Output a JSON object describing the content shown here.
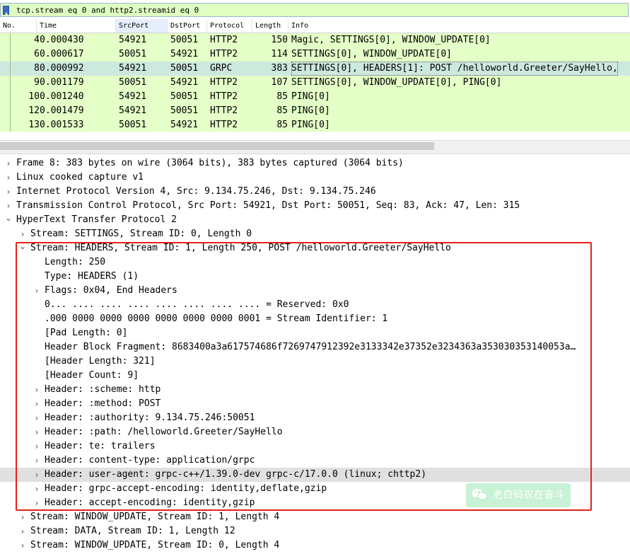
{
  "filter": {
    "value": "tcp.stream eq 0 and http2.streamid eq 0"
  },
  "columns": [
    "No.",
    "Time",
    "SrcPort",
    "DstPort",
    "Protocol",
    "Length",
    "Info"
  ],
  "packets": [
    {
      "no": "4",
      "time": "0.000430",
      "src": "54921",
      "dst": "50051",
      "proto": "HTTP2",
      "len": "150",
      "info": "Magic, SETTINGS[0], WINDOW_UPDATE[0]"
    },
    {
      "no": "6",
      "time": "0.000617",
      "src": "50051",
      "dst": "54921",
      "proto": "HTTP2",
      "len": "114",
      "info": "SETTINGS[0], WINDOW_UPDATE[0]"
    },
    {
      "no": "8",
      "time": "0.000992",
      "src": "54921",
      "dst": "50051",
      "proto": "GRPC",
      "len": "383",
      "info": "SETTINGS[0], HEADERS[1]: POST /helloworld.Greeter/SayHello,"
    },
    {
      "no": "9",
      "time": "0.001179",
      "src": "50051",
      "dst": "54921",
      "proto": "HTTP2",
      "len": "107",
      "info": "SETTINGS[0], WINDOW_UPDATE[0], PING[0]"
    },
    {
      "no": "10",
      "time": "0.001240",
      "src": "54921",
      "dst": "50051",
      "proto": "HTTP2",
      "len": "85",
      "info": "PING[0]"
    },
    {
      "no": "12",
      "time": "0.001479",
      "src": "54921",
      "dst": "50051",
      "proto": "HTTP2",
      "len": "85",
      "info": "PING[0]"
    },
    {
      "no": "13",
      "time": "0.001533",
      "src": "50051",
      "dst": "54921",
      "proto": "HTTP2",
      "len": "85",
      "info": "PING[0]"
    }
  ],
  "tree": [
    {
      "arrow": ">",
      "indent": 0,
      "text": "Frame 8: 383 bytes on wire (3064 bits), 383 bytes captured (3064 bits)"
    },
    {
      "arrow": ">",
      "indent": 0,
      "text": "Linux cooked capture v1"
    },
    {
      "arrow": ">",
      "indent": 0,
      "text": "Internet Protocol Version 4, Src: 9.134.75.246, Dst: 9.134.75.246"
    },
    {
      "arrow": ">",
      "indent": 0,
      "text": "Transmission Control Protocol, Src Port: 54921, Dst Port: 50051, Seq: 83, Ack: 47, Len: 315"
    },
    {
      "arrow": "v",
      "indent": 0,
      "text": "HyperText Transfer Protocol 2"
    },
    {
      "arrow": ">",
      "indent": 1,
      "text": "Stream: SETTINGS, Stream ID: 0, Length 0"
    },
    {
      "arrow": "v",
      "indent": 1,
      "text": "Stream: HEADERS, Stream ID: 1, Length 250, POST /helloworld.Greeter/SayHello"
    },
    {
      "arrow": "",
      "indent": 2,
      "text": "Length: 250"
    },
    {
      "arrow": "",
      "indent": 2,
      "text": "Type: HEADERS (1)"
    },
    {
      "arrow": ">",
      "indent": 2,
      "text": "Flags: 0x04, End Headers"
    },
    {
      "arrow": "",
      "indent": 2,
      "text": "0... .... .... .... .... .... .... .... = Reserved: 0x0"
    },
    {
      "arrow": "",
      "indent": 2,
      "text": ".000 0000 0000 0000 0000 0000 0000 0001 = Stream Identifier: 1"
    },
    {
      "arrow": "",
      "indent": 2,
      "text": "[Pad Length: 0]"
    },
    {
      "arrow": "",
      "indent": 2,
      "text": "Header Block Fragment: 8683400a3a617574686f7269747912392e3133342e37352e3234363a353030353140053a…"
    },
    {
      "arrow": "",
      "indent": 2,
      "text": "[Header Length: 321]"
    },
    {
      "arrow": "",
      "indent": 2,
      "text": "[Header Count: 9]"
    },
    {
      "arrow": ">",
      "indent": 2,
      "text": "Header: :scheme: http"
    },
    {
      "arrow": ">",
      "indent": 2,
      "text": "Header: :method: POST"
    },
    {
      "arrow": ">",
      "indent": 2,
      "text": "Header: :authority: 9.134.75.246:50051"
    },
    {
      "arrow": ">",
      "indent": 2,
      "text": "Header: :path: /helloworld.Greeter/SayHello"
    },
    {
      "arrow": ">",
      "indent": 2,
      "text": "Header: te: trailers"
    },
    {
      "arrow": ">",
      "indent": 2,
      "text": "Header: content-type: application/grpc"
    },
    {
      "arrow": ">",
      "indent": 2,
      "text": "Header: user-agent: grpc-c++/1.39.0-dev grpc-c/17.0.0 (linux; chttp2)"
    },
    {
      "arrow": ">",
      "indent": 2,
      "text": "Header: grpc-accept-encoding: identity,deflate,gzip"
    },
    {
      "arrow": ">",
      "indent": 2,
      "text": "Header: accept-encoding: identity,gzip"
    },
    {
      "arrow": ">",
      "indent": 1,
      "text": "Stream: WINDOW_UPDATE, Stream ID: 1, Length 4"
    },
    {
      "arrow": ">",
      "indent": 1,
      "text": "Stream: DATA, Stream ID: 1, Length 12"
    },
    {
      "arrow": ">",
      "indent": 1,
      "text": "Stream: WINDOW_UPDATE, Stream ID: 0, Length 4"
    }
  ],
  "watermark": {
    "text": "老白码农在奋斗",
    "icon": "wechat-icon"
  },
  "colors": {
    "packet_bg": "#e4ffc7",
    "selected_bg": "#cde8dd",
    "highlight_box": "#e2231a",
    "filter_bg": "#dfffc2"
  }
}
